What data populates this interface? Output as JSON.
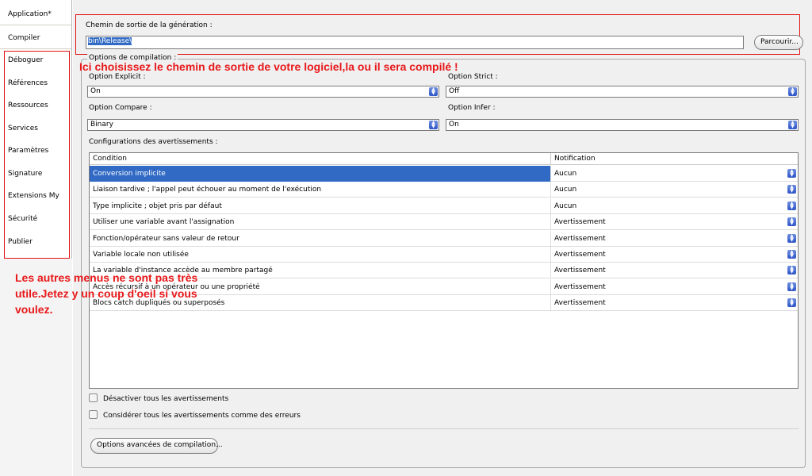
{
  "sidebar": {
    "items": [
      {
        "label": "Application*"
      },
      {
        "label": "Compiler"
      },
      {
        "label": "Déboguer"
      },
      {
        "label": "Références"
      },
      {
        "label": "Ressources"
      },
      {
        "label": "Services"
      },
      {
        "label": "Paramètres"
      },
      {
        "label": "Signature"
      },
      {
        "label": "Extensions My"
      },
      {
        "label": "Sécurité"
      },
      {
        "label": "Publier"
      }
    ],
    "active": "Compiler"
  },
  "output": {
    "label": "Chemin de sortie de la génération :",
    "value": "bin\\Release\\",
    "browse_label": "Parcourir..."
  },
  "options": {
    "legend": "Options de compilation :",
    "explicit": {
      "label": "Option Explicit :",
      "value": "On"
    },
    "strict": {
      "label": "Option Strict :",
      "value": "Off"
    },
    "compare": {
      "label": "Option Compare :",
      "value": "Binary"
    },
    "infer": {
      "label": "Option Infer :",
      "value": "On"
    }
  },
  "warnings": {
    "label": "Configurations des avertissements :",
    "columns": {
      "condition": "Condition",
      "notification": "Notification"
    },
    "rows": [
      {
        "condition": "Conversion implicite",
        "notification": "Aucun"
      },
      {
        "condition": "Liaison tardive ; l'appel peut échouer au moment de l'exécution",
        "notification": "Aucun"
      },
      {
        "condition": "Type implicite ; objet pris par défaut",
        "notification": "Aucun"
      },
      {
        "condition": "Utiliser une variable avant l'assignation",
        "notification": "Avertissement"
      },
      {
        "condition": "Fonction/opérateur sans valeur de retour",
        "notification": "Avertissement"
      },
      {
        "condition": "Variable locale non utilisée",
        "notification": "Avertissement"
      },
      {
        "condition": "La variable d'instance accède au membre partagé",
        "notification": "Avertissement"
      },
      {
        "condition": "Accès récursif à un opérateur ou une propriété",
        "notification": "Avertissement"
      },
      {
        "condition": "Blocs catch dupliqués ou superposés",
        "notification": "Avertissement"
      }
    ],
    "selected_row": 0
  },
  "checks": {
    "disable_all": "Désactiver tous les avertissements",
    "treat_as_errors": "Considérer tous les avertissements comme des erreurs"
  },
  "advanced_button": "Options avancées de compilation...",
  "annotations": {
    "top": "Ici choisissez le chemin de sortie de votre logiciel,la ou il sera compilé !",
    "side": "Les autres menus ne sont pas très utile.Jetez y un coup d'oeil si vous voulez."
  },
  "colors": {
    "selection": "#316ac5",
    "annotation": "#e8181a",
    "dropdown_arrow": "#2e55c8"
  }
}
